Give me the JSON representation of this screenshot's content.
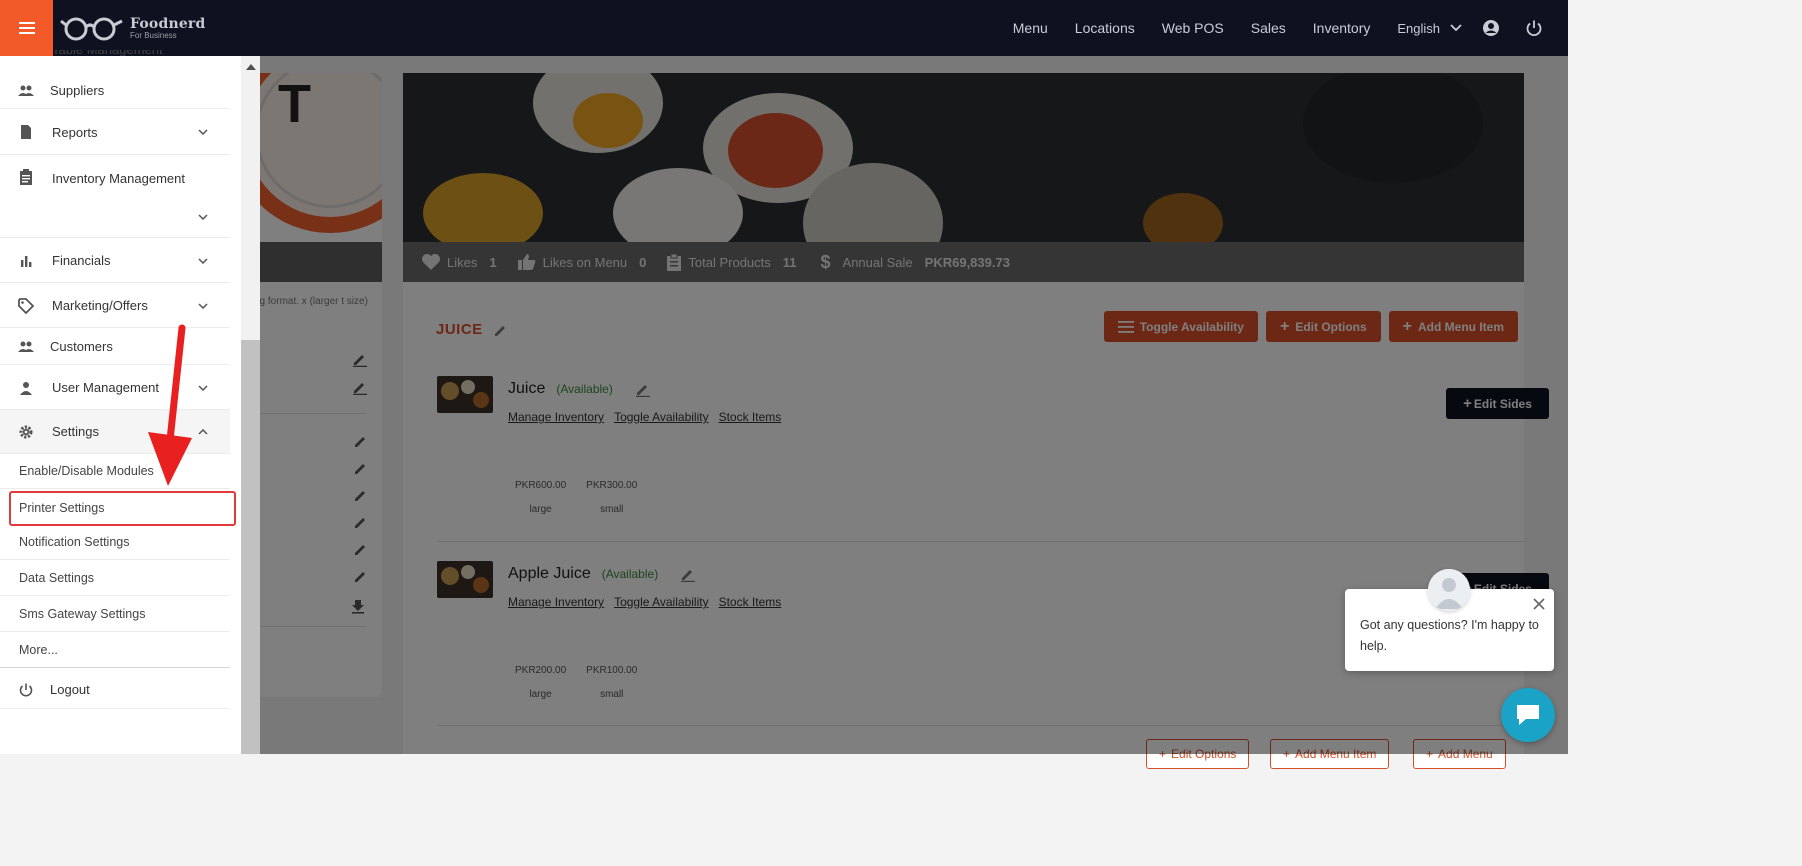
{
  "brand": {
    "name": "Foodnerd",
    "tagline": "For Business",
    "accent": "#f25a2a"
  },
  "topnav": {
    "links": [
      "Menu",
      "Locations",
      "Web POS",
      "Sales",
      "Inventory"
    ],
    "language": "English"
  },
  "sidebar": {
    "cut_off_label": "Table Management",
    "items": [
      {
        "label": "Suppliers",
        "icon": "people-icon",
        "has_chevron": false
      },
      {
        "label": "Reports",
        "icon": "file-icon",
        "has_chevron": true
      },
      {
        "label": "Inventory Management",
        "icon": "clipboard-icon",
        "has_chevron": true
      },
      {
        "label": "Financials",
        "icon": "bar-chart-icon",
        "has_chevron": true
      },
      {
        "label": "Marketing/Offers",
        "icon": "tag-icon",
        "has_chevron": true
      },
      {
        "label": "Customers",
        "icon": "people-icon",
        "has_chevron": false
      },
      {
        "label": "User Management",
        "icon": "person-icon",
        "has_chevron": true
      },
      {
        "label": "Settings",
        "icon": "gear-icon",
        "has_chevron": true,
        "expanded": true
      }
    ],
    "settings_sub": [
      "Enable/Disable Modules",
      "Printer Settings",
      "Notification Settings",
      "Data Settings",
      "Sms Gateway Settings",
      "More..."
    ],
    "logout": "Logout"
  },
  "left_card": {
    "note": "ng format. x (larger t size)"
  },
  "stats": {
    "likes_label": "Likes",
    "likes": "1",
    "likes_on_menu_label": "Likes on Menu",
    "likes_on_menu": "0",
    "total_products_label": "Total Products",
    "total_products": "11",
    "annual_sale_label": "Annual Sale",
    "annual_sale": "PKR69,839.73"
  },
  "category": {
    "title": "JUICE",
    "buttons": [
      "Toggle Availability",
      "Edit Options",
      "Add Menu Item"
    ]
  },
  "items": [
    {
      "name": "Juice",
      "availability": "(Available)",
      "links": [
        "Manage Inventory",
        "Toggle Availability",
        "Stock Items"
      ],
      "prices": [
        {
          "price": "PKR600.00",
          "size": "large"
        },
        {
          "price": "PKR300.00",
          "size": "small"
        }
      ],
      "edit_sides": "Edit Sides"
    },
    {
      "name": "Apple Juice",
      "availability": "(Available)",
      "links": [
        "Manage Inventory",
        "Toggle Availability",
        "Stock Items"
      ],
      "prices": [
        {
          "price": "PKR200.00",
          "size": "large"
        },
        {
          "price": "PKR100.00",
          "size": "small"
        }
      ],
      "edit_sides": "Edit Sides"
    }
  ],
  "bottom_buttons": [
    "Edit Options",
    "Add Menu Item",
    "Add Menu"
  ],
  "chat": {
    "message": "Got any questions? I'm happy to help."
  }
}
